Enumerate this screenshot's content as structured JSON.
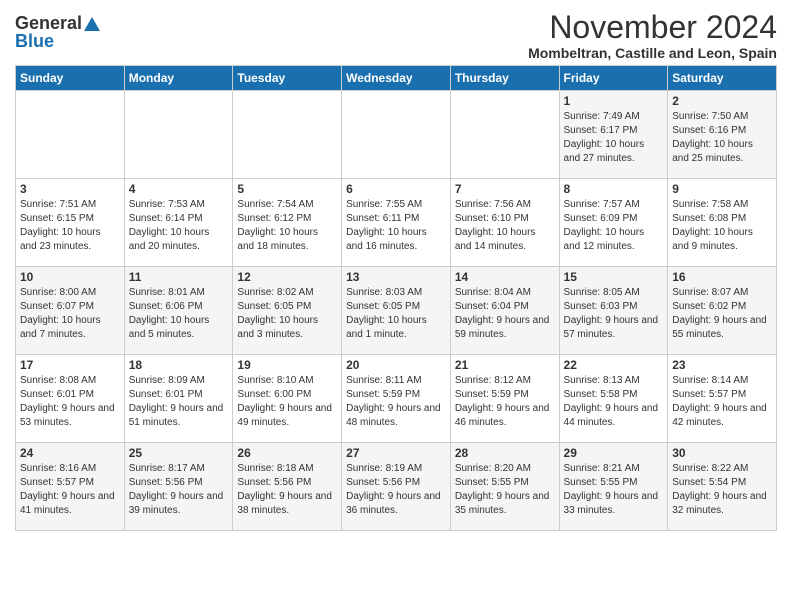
{
  "header": {
    "logo_general": "General",
    "logo_blue": "Blue",
    "month": "November 2024",
    "location": "Mombeltran, Castille and Leon, Spain"
  },
  "weekdays": [
    "Sunday",
    "Monday",
    "Tuesday",
    "Wednesday",
    "Thursday",
    "Friday",
    "Saturday"
  ],
  "weeks": [
    [
      {
        "day": "",
        "info": ""
      },
      {
        "day": "",
        "info": ""
      },
      {
        "day": "",
        "info": ""
      },
      {
        "day": "",
        "info": ""
      },
      {
        "day": "",
        "info": ""
      },
      {
        "day": "1",
        "info": "Sunrise: 7:49 AM\nSunset: 6:17 PM\nDaylight: 10 hours\nand 27 minutes."
      },
      {
        "day": "2",
        "info": "Sunrise: 7:50 AM\nSunset: 6:16 PM\nDaylight: 10 hours\nand 25 minutes."
      }
    ],
    [
      {
        "day": "3",
        "info": "Sunrise: 7:51 AM\nSunset: 6:15 PM\nDaylight: 10 hours\nand 23 minutes."
      },
      {
        "day": "4",
        "info": "Sunrise: 7:53 AM\nSunset: 6:14 PM\nDaylight: 10 hours\nand 20 minutes."
      },
      {
        "day": "5",
        "info": "Sunrise: 7:54 AM\nSunset: 6:12 PM\nDaylight: 10 hours\nand 18 minutes."
      },
      {
        "day": "6",
        "info": "Sunrise: 7:55 AM\nSunset: 6:11 PM\nDaylight: 10 hours\nand 16 minutes."
      },
      {
        "day": "7",
        "info": "Sunrise: 7:56 AM\nSunset: 6:10 PM\nDaylight: 10 hours\nand 14 minutes."
      },
      {
        "day": "8",
        "info": "Sunrise: 7:57 AM\nSunset: 6:09 PM\nDaylight: 10 hours\nand 12 minutes."
      },
      {
        "day": "9",
        "info": "Sunrise: 7:58 AM\nSunset: 6:08 PM\nDaylight: 10 hours\nand 9 minutes."
      }
    ],
    [
      {
        "day": "10",
        "info": "Sunrise: 8:00 AM\nSunset: 6:07 PM\nDaylight: 10 hours\nand 7 minutes."
      },
      {
        "day": "11",
        "info": "Sunrise: 8:01 AM\nSunset: 6:06 PM\nDaylight: 10 hours\nand 5 minutes."
      },
      {
        "day": "12",
        "info": "Sunrise: 8:02 AM\nSunset: 6:05 PM\nDaylight: 10 hours\nand 3 minutes."
      },
      {
        "day": "13",
        "info": "Sunrise: 8:03 AM\nSunset: 6:05 PM\nDaylight: 10 hours\nand 1 minute."
      },
      {
        "day": "14",
        "info": "Sunrise: 8:04 AM\nSunset: 6:04 PM\nDaylight: 9 hours\nand 59 minutes."
      },
      {
        "day": "15",
        "info": "Sunrise: 8:05 AM\nSunset: 6:03 PM\nDaylight: 9 hours\nand 57 minutes."
      },
      {
        "day": "16",
        "info": "Sunrise: 8:07 AM\nSunset: 6:02 PM\nDaylight: 9 hours\nand 55 minutes."
      }
    ],
    [
      {
        "day": "17",
        "info": "Sunrise: 8:08 AM\nSunset: 6:01 PM\nDaylight: 9 hours\nand 53 minutes."
      },
      {
        "day": "18",
        "info": "Sunrise: 8:09 AM\nSunset: 6:01 PM\nDaylight: 9 hours\nand 51 minutes."
      },
      {
        "day": "19",
        "info": "Sunrise: 8:10 AM\nSunset: 6:00 PM\nDaylight: 9 hours\nand 49 minutes."
      },
      {
        "day": "20",
        "info": "Sunrise: 8:11 AM\nSunset: 5:59 PM\nDaylight: 9 hours\nand 48 minutes."
      },
      {
        "day": "21",
        "info": "Sunrise: 8:12 AM\nSunset: 5:59 PM\nDaylight: 9 hours\nand 46 minutes."
      },
      {
        "day": "22",
        "info": "Sunrise: 8:13 AM\nSunset: 5:58 PM\nDaylight: 9 hours\nand 44 minutes."
      },
      {
        "day": "23",
        "info": "Sunrise: 8:14 AM\nSunset: 5:57 PM\nDaylight: 9 hours\nand 42 minutes."
      }
    ],
    [
      {
        "day": "24",
        "info": "Sunrise: 8:16 AM\nSunset: 5:57 PM\nDaylight: 9 hours\nand 41 minutes."
      },
      {
        "day": "25",
        "info": "Sunrise: 8:17 AM\nSunset: 5:56 PM\nDaylight: 9 hours\nand 39 minutes."
      },
      {
        "day": "26",
        "info": "Sunrise: 8:18 AM\nSunset: 5:56 PM\nDaylight: 9 hours\nand 38 minutes."
      },
      {
        "day": "27",
        "info": "Sunrise: 8:19 AM\nSunset: 5:56 PM\nDaylight: 9 hours\nand 36 minutes."
      },
      {
        "day": "28",
        "info": "Sunrise: 8:20 AM\nSunset: 5:55 PM\nDaylight: 9 hours\nand 35 minutes."
      },
      {
        "day": "29",
        "info": "Sunrise: 8:21 AM\nSunset: 5:55 PM\nDaylight: 9 hours\nand 33 minutes."
      },
      {
        "day": "30",
        "info": "Sunrise: 8:22 AM\nSunset: 5:54 PM\nDaylight: 9 hours\nand 32 minutes."
      }
    ]
  ]
}
